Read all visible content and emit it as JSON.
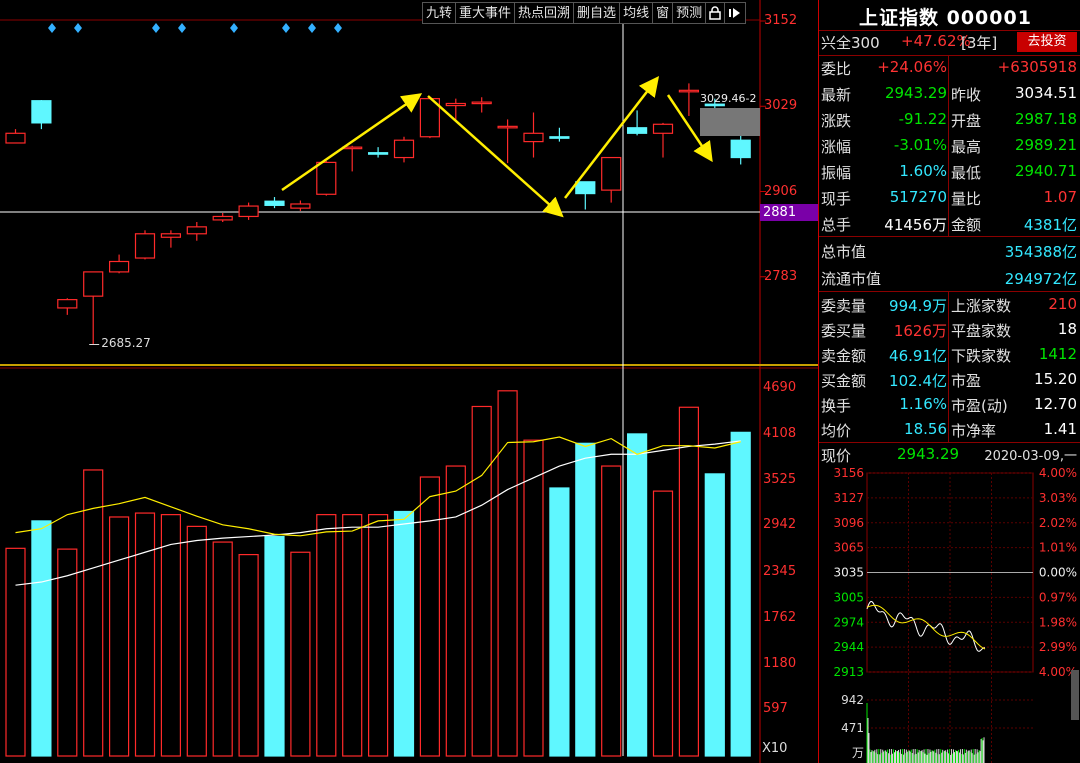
{
  "toolbar": {
    "buttons": [
      "九转",
      "重大事件",
      "热点回溯",
      "删自选",
      "均线",
      "窗",
      "预测"
    ],
    "lock_icon": "lock-icon",
    "nav_icon": "forward-icon"
  },
  "main_chart": {
    "price_ticks": [
      "3152",
      "3029",
      "2906",
      "2881",
      "2783"
    ],
    "crosshair_label": "2881",
    "low_label": "2685.27",
    "high_label": "3029.46-2",
    "colors": {
      "up": "#ff2a2a",
      "down": "#5ff7ff",
      "ma1": "#ffee00",
      "ma2": "#ffffff",
      "arrow": "#ffee00",
      "markers": "#33b0ff",
      "crosshair": "#ffffff"
    }
  },
  "volume_chart": {
    "ticks": [
      "4690",
      "4108",
      "3525",
      "2942",
      "2345",
      "1762",
      "1180",
      "597",
      "X10"
    ]
  },
  "chart_data": {
    "type": "candlestick",
    "candles": [
      {
        "o": 2990,
        "h": 2996,
        "l": 2980,
        "c": 2976,
        "up": true
      },
      {
        "o": 3037,
        "h": 3038,
        "l": 2996,
        "c": 3005,
        "up": false
      },
      {
        "o": 2738,
        "h": 2752,
        "l": 2728,
        "c": 2750,
        "up": true
      },
      {
        "o": 2755,
        "h": 2790,
        "l": 2685.27,
        "c": 2790,
        "up": true
      },
      {
        "o": 2790,
        "h": 2815,
        "l": 2788,
        "c": 2805,
        "up": true
      },
      {
        "o": 2810,
        "h": 2850,
        "l": 2808,
        "c": 2845,
        "up": true
      },
      {
        "o": 2840,
        "h": 2850,
        "l": 2825,
        "c": 2845,
        "up": true
      },
      {
        "o": 2845,
        "h": 2862,
        "l": 2835,
        "c": 2855,
        "up": true
      },
      {
        "o": 2865,
        "h": 2875,
        "l": 2862,
        "c": 2870,
        "up": true
      },
      {
        "o": 2870,
        "h": 2890,
        "l": 2865,
        "c": 2885,
        "up": true
      },
      {
        "o": 2892,
        "h": 2898,
        "l": 2882,
        "c": 2886,
        "up": false
      },
      {
        "o": 2882,
        "h": 2893,
        "l": 2878,
        "c": 2888,
        "up": true
      },
      {
        "o": 2902,
        "h": 2950,
        "l": 2900,
        "c": 2948,
        "up": true
      },
      {
        "o": 2970,
        "h": 2972,
        "l": 2935,
        "c": 2970,
        "up": true
      },
      {
        "o": 2962,
        "h": 2970,
        "l": 2955,
        "c": 2962,
        "up": false
      },
      {
        "o": 2955,
        "h": 2985,
        "l": 2948,
        "c": 2980,
        "up": true
      },
      {
        "o": 2985,
        "h": 3040,
        "l": 2983,
        "c": 3040,
        "up": true
      },
      {
        "o": 3030,
        "h": 3040,
        "l": 3010,
        "c": 3033,
        "up": true
      },
      {
        "o": 3035,
        "h": 3042,
        "l": 3020,
        "c": 3034,
        "up": true
      },
      {
        "o": 3000,
        "h": 3010,
        "l": 2947,
        "c": 3000,
        "up": true
      },
      {
        "o": 2990,
        "h": 3020,
        "l": 2955,
        "c": 2978,
        "up": true
      },
      {
        "o": 2983,
        "h": 2998,
        "l": 2978,
        "c": 2985,
        "up": false
      },
      {
        "o": 2903,
        "h": 2913,
        "l": 2880,
        "c": 2920,
        "up": false
      },
      {
        "o": 2908,
        "h": 2955,
        "l": 2890,
        "c": 2955,
        "up": true
      },
      {
        "o": 2998,
        "h": 3023,
        "l": 2987,
        "c": 2990,
        "up": false
      },
      {
        "o": 2990,
        "h": 3005,
        "l": 2955,
        "c": 3003,
        "up": true
      },
      {
        "o": 3052,
        "h": 3062,
        "l": 3015,
        "c": 3052,
        "up": true
      },
      {
        "o": 3032,
        "h": 3040,
        "l": 3020,
        "c": 3032,
        "up": false
      },
      {
        "o": 2955,
        "h": 2988,
        "l": 2945,
        "c": 2980,
        "up": false
      }
    ],
    "volumes": [
      {
        "v": 2650,
        "up": true
      },
      {
        "v": 3000,
        "up": false
      },
      {
        "v": 2640,
        "up": true
      },
      {
        "v": 3650,
        "up": true
      },
      {
        "v": 3050,
        "up": true
      },
      {
        "v": 3100,
        "up": true
      },
      {
        "v": 3080,
        "up": true
      },
      {
        "v": 2930,
        "up": true
      },
      {
        "v": 2730,
        "up": true
      },
      {
        "v": 2570,
        "up": true
      },
      {
        "v": 2800,
        "up": false
      },
      {
        "v": 2600,
        "up": true
      },
      {
        "v": 3080,
        "up": true
      },
      {
        "v": 3080,
        "up": true
      },
      {
        "v": 3080,
        "up": true
      },
      {
        "v": 3120,
        "up": false
      },
      {
        "v": 3560,
        "up": true
      },
      {
        "v": 3700,
        "up": true
      },
      {
        "v": 4460,
        "up": true
      },
      {
        "v": 4660,
        "up": true
      },
      {
        "v": 4030,
        "up": true
      },
      {
        "v": 3420,
        "up": false
      },
      {
        "v": 3990,
        "up": false
      },
      {
        "v": 3700,
        "up": true
      },
      {
        "v": 4110,
        "up": false
      },
      {
        "v": 3380,
        "up": true
      },
      {
        "v": 4450,
        "up": true
      },
      {
        "v": 3600,
        "up": false
      },
      {
        "v": 4130,
        "up": false
      }
    ],
    "ma_yellow": [
      2850,
      2900,
      3080,
      3160,
      3220,
      3300,
      3180,
      3060,
      2950,
      2900,
      2830,
      2810,
      2860,
      2870,
      3000,
      3020,
      3310,
      3380,
      3580,
      4000,
      4010,
      4070,
      3950,
      4050,
      3850,
      3960,
      3960,
      3930,
      4010
    ],
    "ma_white": [
      2180,
      2220,
      2300,
      2400,
      2500,
      2600,
      2700,
      2750,
      2780,
      2800,
      2820,
      2850,
      2900,
      2920,
      2920,
      2960,
      3000,
      3050,
      3200,
      3400,
      3550,
      3700,
      3800,
      3850,
      3850,
      3900,
      3950,
      3980,
      4020
    ],
    "ylim_price": [
      2660,
      3165
    ],
    "ylim_volume": [
      0,
      4900
    ]
  },
  "quote": {
    "title": "上证指数 000001",
    "sector": "兴全300",
    "sector_change": "+47.62%",
    "sector_period": "[3年]",
    "invest_button": "去投资",
    "rows": [
      {
        "l1": "委比",
        "v1": "+24.06%",
        "v1c": "red",
        "l2": "",
        "v2": "+6305918",
        "v2c": "red"
      },
      {
        "l1": "最新",
        "v1": "2943.29",
        "v1c": "green",
        "l2": "昨收",
        "v2": "3034.51",
        "v2c": "white"
      },
      {
        "l1": "涨跌",
        "v1": "-91.22",
        "v1c": "green",
        "l2": "开盘",
        "v2": "2987.18",
        "v2c": "green"
      },
      {
        "l1": "涨幅",
        "v1": "-3.01%",
        "v1c": "green",
        "l2": "最高",
        "v2": "2989.21",
        "v2c": "green"
      },
      {
        "l1": "振幅",
        "v1": "1.60%",
        "v1c": "cyan",
        "l2": "最低",
        "v2": "2940.71",
        "v2c": "green"
      },
      {
        "l1": "现手",
        "v1": "517270",
        "v1c": "cyan",
        "l2": "量比",
        "v2": "1.07",
        "v2c": "red"
      },
      {
        "l1": "总手",
        "v1": "41456万",
        "v1c": "white",
        "l2": "金额",
        "v2": "4381亿",
        "v2c": "cyan"
      }
    ],
    "mcap": [
      {
        "label": "总市值",
        "value": "354388亿"
      },
      {
        "label": "流通市值",
        "value": "294972亿"
      }
    ],
    "rows2": [
      {
        "l1": "委卖量",
        "v1": "994.9万",
        "v1c": "cyan",
        "l2": "上涨家数",
        "v2": "210",
        "v2c": "red"
      },
      {
        "l1": "委买量",
        "v1": "1626万",
        "v1c": "red",
        "l2": "平盘家数",
        "v2": "18",
        "v2c": "white"
      },
      {
        "l1": "卖金额",
        "v1": "46.91亿",
        "v1c": "cyan",
        "l2": "下跌家数",
        "v2": "1412",
        "v2c": "green"
      },
      {
        "l1": "买金额",
        "v1": "102.4亿",
        "v1c": "cyan",
        "l2": "市盈",
        "v2": "15.20",
        "v2c": "white"
      },
      {
        "l1": "换手",
        "v1": "1.16%",
        "v1c": "cyan",
        "l2": "市盈(动)",
        "v2": "12.70",
        "v2c": "white"
      },
      {
        "l1": "均价",
        "v1": "18.56",
        "v1c": "cyan",
        "l2": "市净率",
        "v2": "1.41",
        "v2c": "white"
      }
    ]
  },
  "mini_chart": {
    "label": "现价",
    "price": "2943.29",
    "date": "2020-03-09,一",
    "left_ticks": [
      "3156",
      "3127",
      "3096",
      "3065",
      "3035",
      "3005",
      "2974",
      "2944",
      "2913"
    ],
    "right_ticks": [
      "4.00%",
      "3.03%",
      "2.02%",
      "1.01%",
      "0.00%",
      "0.97%",
      "1.98%",
      "2.99%",
      "4.00%"
    ],
    "vol_ticks": [
      "942",
      "471"
    ],
    "vol_unit": "万"
  }
}
